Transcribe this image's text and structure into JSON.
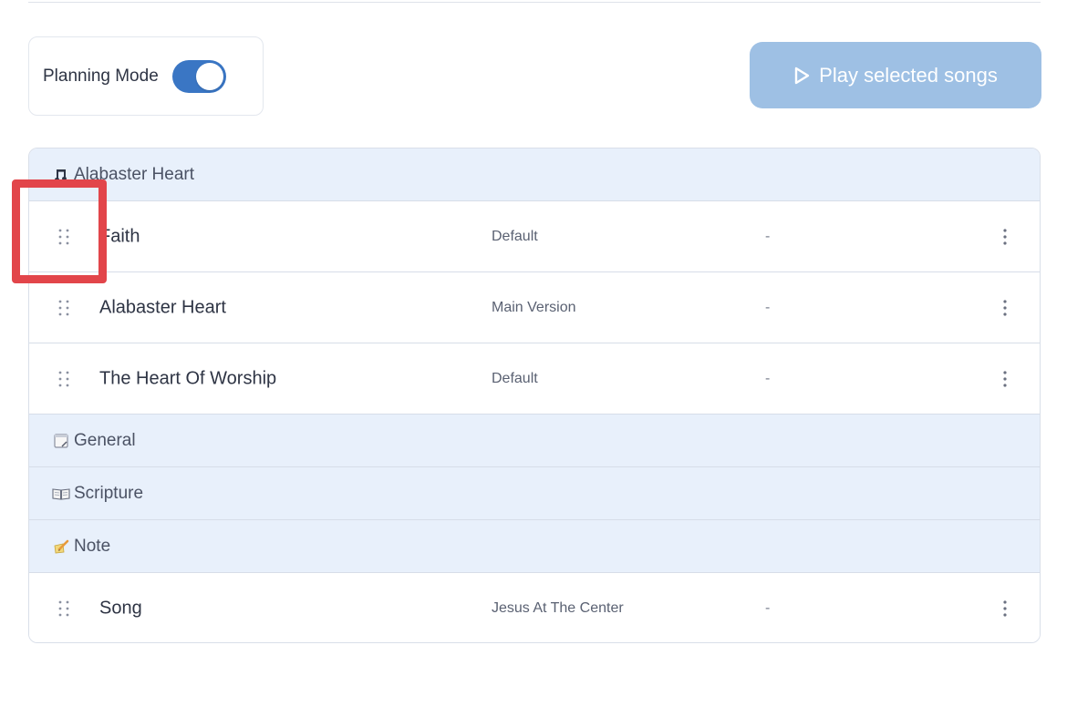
{
  "planning": {
    "label": "Planning Mode",
    "enabled": true
  },
  "toolbar": {
    "play_label": "Play selected songs",
    "play_icon": "play-outline-icon"
  },
  "colors": {
    "accent": "#3a76c4",
    "play_button": "#9ec0e4",
    "header_bg": "#e8f0fb",
    "highlight": "#e2454a"
  },
  "sections": {
    "alabaster": {
      "label": "Alabaster Heart",
      "icon": "music-note-icon"
    },
    "general": {
      "label": "General",
      "icon": "notepad-icon"
    },
    "scripture": {
      "label": "Scripture",
      "icon": "open-book-icon"
    },
    "note": {
      "label": "Note",
      "icon": "memo-pencil-icon"
    }
  },
  "items": [
    {
      "title": "Faith",
      "version": "Default",
      "key": "-"
    },
    {
      "title": "Alabaster Heart",
      "version": "Main Version",
      "key": "-"
    },
    {
      "title": "The Heart Of Worship",
      "version": "Default",
      "key": "-"
    },
    {
      "title": "Song",
      "version": "Jesus At The Center",
      "key": "-"
    }
  ]
}
